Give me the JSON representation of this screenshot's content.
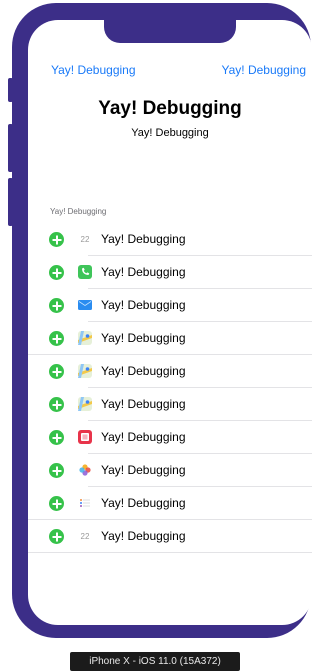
{
  "nav": {
    "left_label": "Yay! Debugging",
    "right_label": "Yay! Debugging"
  },
  "header": {
    "title": "Yay! Debugging",
    "subtitle": "Yay! Debugging"
  },
  "section": {
    "header": "Yay! Debugging"
  },
  "rows": [
    {
      "label": "Yay! Debugging",
      "icon": "calendar-icon",
      "icon_glyph": "22"
    },
    {
      "label": "Yay! Debugging",
      "icon": "phone-icon",
      "icon_glyph": "☏"
    },
    {
      "label": "Yay! Debugging",
      "icon": "mail-icon",
      "icon_glyph": "✉"
    },
    {
      "label": "Yay! Debugging",
      "icon": "maps-icon",
      "icon_glyph": "⚲"
    },
    {
      "label": "Yay! Debugging",
      "icon": "maps-icon",
      "icon_glyph": "⚲"
    },
    {
      "label": "Yay! Debugging",
      "icon": "maps-icon",
      "icon_glyph": "⚲"
    },
    {
      "label": "Yay! Debugging",
      "icon": "photo-booth-icon",
      "icon_glyph": "▣"
    },
    {
      "label": "Yay! Debugging",
      "icon": "photos-icon",
      "icon_glyph": "✿"
    },
    {
      "label": "Yay! Debugging",
      "icon": "reminders-icon",
      "icon_glyph": "☰"
    },
    {
      "label": "Yay! Debugging",
      "icon": "calendar-icon",
      "icon_glyph": "22"
    }
  ],
  "device_caption": "iPhone X - iOS 11.0 (15A372)",
  "colors": {
    "device_frame": "#3c2e88",
    "accent": "#1a7af8",
    "add_green": "#36c24a"
  }
}
